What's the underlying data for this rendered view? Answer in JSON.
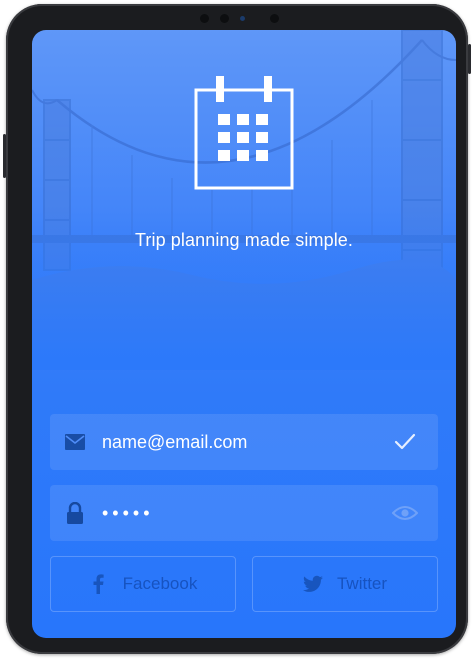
{
  "app": {
    "tagline": "Trip planning made simple."
  },
  "login": {
    "email_value": "name@email.com",
    "password_value": "•••••"
  },
  "social": {
    "facebook_label": "Facebook",
    "twitter_label": "Twitter"
  },
  "colors": {
    "accent": "#2876fb",
    "field_bg": "rgba(255,255,255,0.10)",
    "text": "#ffffff"
  },
  "icons": {
    "logo": "calendar-icon",
    "email": "envelope-icon",
    "email_valid": "checkmark-icon",
    "password": "lock-icon",
    "password_toggle": "eye-icon",
    "facebook": "facebook-icon",
    "twitter": "twitter-icon"
  }
}
